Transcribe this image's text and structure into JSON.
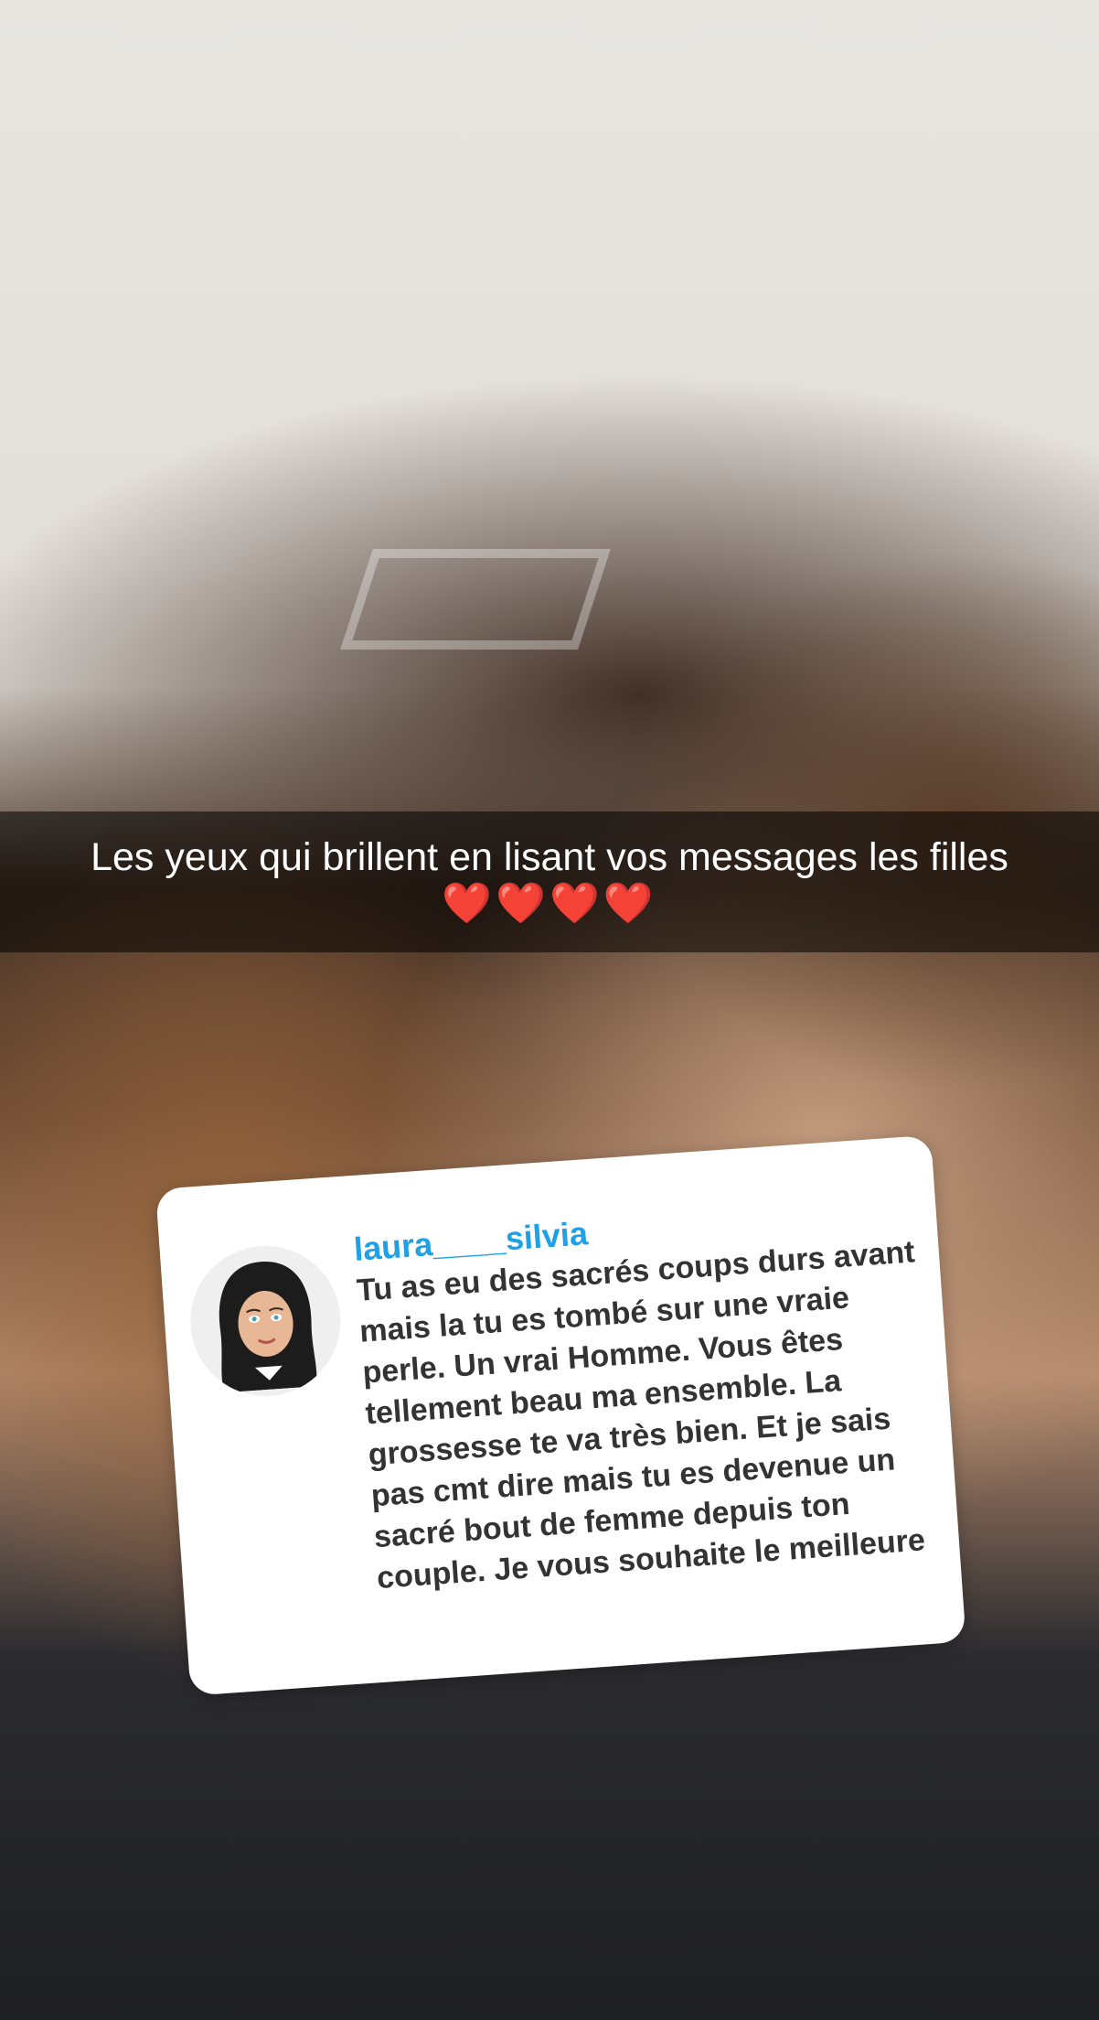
{
  "caption": {
    "text": "Les yeux qui brillent en lisant vos messages les filles",
    "emoji": "❤️❤️❤️❤️"
  },
  "reply_card": {
    "username": "laura____silvia",
    "avatar_icon": "bitmoji-avatar-icon",
    "message": "Tu as eu des sacrés coups durs avant mais la tu es tombé sur une vraie perle. Un vrai Homme. Vous êtes tellement beau ma ensemble. La grossesse te va très bien. Et je sais pas cmt dire mais tu es devenue un sacré bout de femme depuis ton couple. Je vous souhaite le meilleure"
  },
  "colors": {
    "username": "#1ea1e6",
    "caption_bar": "rgba(0,0,0,0.55)",
    "heart": "#e0262b"
  }
}
